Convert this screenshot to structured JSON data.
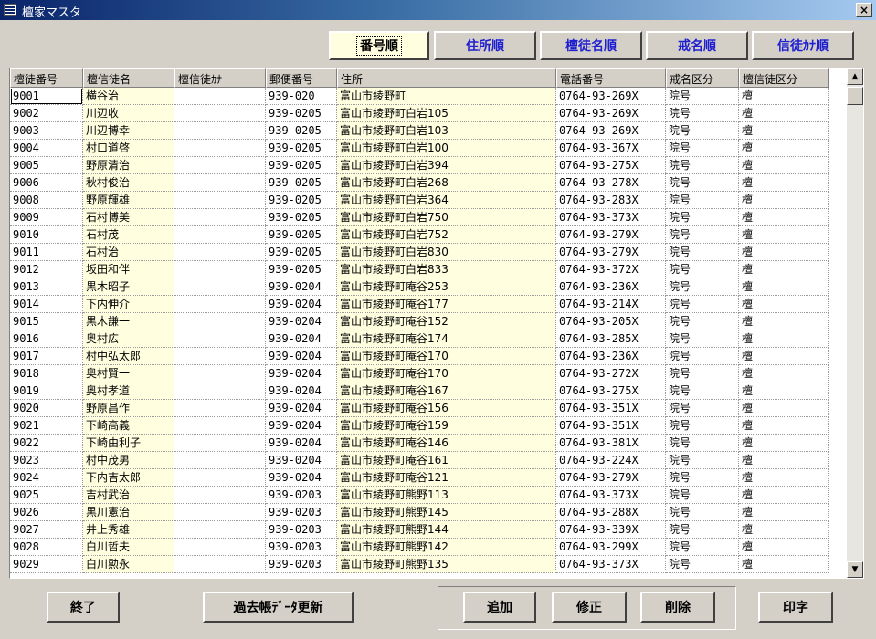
{
  "window": {
    "title": "檀家マスタ",
    "close_label": "×"
  },
  "sort_buttons": [
    {
      "label": "番号順",
      "active": true
    },
    {
      "label": "住所順",
      "active": false
    },
    {
      "label": "檀徒名順",
      "active": false
    },
    {
      "label": "戒名順",
      "active": false
    },
    {
      "label": "信徒ｶﾅ順",
      "active": false
    }
  ],
  "table": {
    "columns": [
      "檀徒番号",
      "檀信徒名",
      "檀信徒ｶﾅ",
      "郵便番号",
      "住所",
      "電話番号",
      "戒名区分",
      "檀信徒区分"
    ],
    "rows": [
      [
        "9001",
        "横谷治",
        "",
        "939-020",
        "富山市綾野町",
        "0764-93-269X",
        "院号",
        "檀"
      ],
      [
        "9002",
        "川辺收",
        "",
        "939-0205",
        "富山市綾野町白岩105",
        "0764-93-269X",
        "院号",
        "檀"
      ],
      [
        "9003",
        "川辺博幸",
        "",
        "939-0205",
        "富山市綾野町白岩103",
        "0764-93-269X",
        "院号",
        "檀"
      ],
      [
        "9004",
        "村口道啓",
        "",
        "939-0205",
        "富山市綾野町白岩100",
        "0764-93-367X",
        "院号",
        "檀"
      ],
      [
        "9005",
        "野原清治",
        "",
        "939-0205",
        "富山市綾野町白岩394",
        "0764-93-275X",
        "院号",
        "檀"
      ],
      [
        "9006",
        "秋村俊治",
        "",
        "939-0205",
        "富山市綾野町白岩268",
        "0764-93-278X",
        "院号",
        "檀"
      ],
      [
        "9008",
        "野原輝雄",
        "",
        "939-0205",
        "富山市綾野町白岩364",
        "0764-93-283X",
        "院号",
        "檀"
      ],
      [
        "9009",
        "石村博美",
        "",
        "939-0205",
        "富山市綾野町白岩750",
        "0764-93-373X",
        "院号",
        "檀"
      ],
      [
        "9010",
        "石村茂",
        "",
        "939-0205",
        "富山市綾野町白岩752",
        "0764-93-279X",
        "院号",
        "檀"
      ],
      [
        "9011",
        "石村治",
        "",
        "939-0205",
        "富山市綾野町白岩830",
        "0764-93-279X",
        "院号",
        "檀"
      ],
      [
        "9012",
        "坂田和伴",
        "",
        "939-0205",
        "富山市綾野町白岩833",
        "0764-93-372X",
        "院号",
        "檀"
      ],
      [
        "9013",
        "黒木昭子",
        "",
        "939-0204",
        "富山市綾野町庵谷253",
        "0764-93-236X",
        "院号",
        "檀"
      ],
      [
        "9014",
        "下内伸介",
        "",
        "939-0204",
        "富山市綾野町庵谷177",
        "0764-93-214X",
        "院号",
        "檀"
      ],
      [
        "9015",
        "黒木謙一",
        "",
        "939-0204",
        "富山市綾野町庵谷152",
        "0764-93-205X",
        "院号",
        "檀"
      ],
      [
        "9016",
        "奥村広",
        "",
        "939-0204",
        "富山市綾野町庵谷174",
        "0764-93-285X",
        "院号",
        "檀"
      ],
      [
        "9017",
        "村中弘太郎",
        "",
        "939-0204",
        "富山市綾野町庵谷170",
        "0764-93-236X",
        "院号",
        "檀"
      ],
      [
        "9018",
        "奥村賢一",
        "",
        "939-0204",
        "富山市綾野町庵谷170",
        "0764-93-272X",
        "院号",
        "檀"
      ],
      [
        "9019",
        "奥村孝道",
        "",
        "939-0204",
        "富山市綾野町庵谷167",
        "0764-93-275X",
        "院号",
        "檀"
      ],
      [
        "9020",
        "野原昌作",
        "",
        "939-0204",
        "富山市綾野町庵谷156",
        "0764-93-351X",
        "院号",
        "檀"
      ],
      [
        "9021",
        "下崎高義",
        "",
        "939-0204",
        "富山市綾野町庵谷159",
        "0764-93-351X",
        "院号",
        "檀"
      ],
      [
        "9022",
        "下崎由利子",
        "",
        "939-0204",
        "富山市綾野町庵谷146",
        "0764-93-381X",
        "院号",
        "檀"
      ],
      [
        "9023",
        "村中茂男",
        "",
        "939-0204",
        "富山市綾野町庵谷161",
        "0764-93-224X",
        "院号",
        "檀"
      ],
      [
        "9024",
        "下内吉太郎",
        "",
        "939-0204",
        "富山市綾野町庵谷121",
        "0764-93-279X",
        "院号",
        "檀"
      ],
      [
        "9025",
        "吉村武治",
        "",
        "939-0203",
        "富山市綾野町熊野113",
        "0764-93-373X",
        "院号",
        "檀"
      ],
      [
        "9026",
        "黒川憲治",
        "",
        "939-0203",
        "富山市綾野町熊野145",
        "0764-93-288X",
        "院号",
        "檀"
      ],
      [
        "9027",
        "井上秀雄",
        "",
        "939-0203",
        "富山市綾野町熊野144",
        "0764-93-339X",
        "院号",
        "檀"
      ],
      [
        "9028",
        "白川哲夫",
        "",
        "939-0203",
        "富山市綾野町熊野142",
        "0764-93-299X",
        "院号",
        "檀"
      ],
      [
        "9029",
        "白川勲永",
        "",
        "939-0203",
        "富山市綾野町熊野135",
        "0764-93-373X",
        "院号",
        "檀"
      ]
    ],
    "scroll_up_icon": "scroll-up-arrow-icon",
    "scroll_down_icon": "scroll-down-arrow-icon"
  },
  "footer": {
    "exit_label": "終了",
    "update_label": "過去帳ﾃﾞｰﾀ更新",
    "add_label": "追加",
    "edit_label": "修正",
    "delete_label": "削除",
    "print_label": "印字"
  },
  "colors": {
    "title_gradient_start": "#0a246a",
    "title_gradient_end": "#a6caf0",
    "highlight_column": "#ffffe0",
    "sort_button_text": "#1f1fd0"
  }
}
